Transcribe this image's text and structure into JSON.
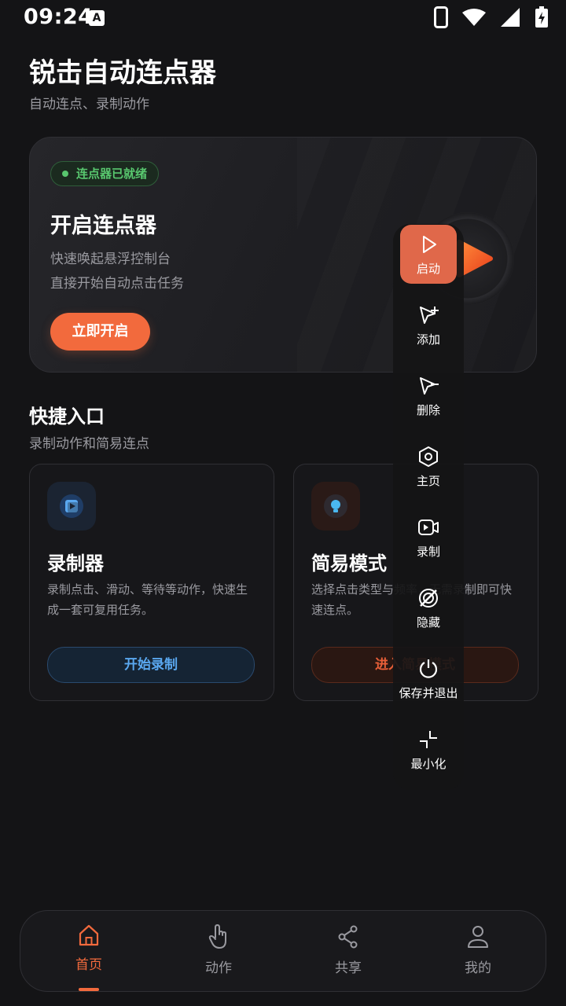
{
  "status_bar": {
    "time": "09:24",
    "badge_letter": "A"
  },
  "header": {
    "title": "锐击自动连点器",
    "subtitle": "自动连点、录制动作"
  },
  "hero": {
    "badge": "连点器已就绪",
    "title": "开启连点器",
    "desc_line1": "快速唤起悬浮控制台",
    "desc_line2": "直接开始自动点击任务",
    "button": "立即开启"
  },
  "quick": {
    "title": "快捷入口",
    "subtitle": "录制动作和简易连点",
    "cards": [
      {
        "title": "录制器",
        "desc": "录制点击、滑动、等待等动作，快速生成一套可复用任务。",
        "button": "开始录制",
        "icon": "record-video-icon"
      },
      {
        "title": "简易模式",
        "desc": "选择点击类型与频率，无需录制即可快速连点。",
        "button": "进入简易模式",
        "icon": "lightbulb-icon"
      }
    ]
  },
  "float_panel": {
    "items": [
      {
        "label": "启动",
        "icon": "play-icon"
      },
      {
        "label": "添加",
        "icon": "cursor-plus-icon"
      },
      {
        "label": "删除",
        "icon": "cursor-minus-icon"
      },
      {
        "label": "主页",
        "icon": "hexagon-icon"
      },
      {
        "label": "录制",
        "icon": "video-record-icon"
      },
      {
        "label": "隐藏",
        "icon": "hide-icon"
      },
      {
        "label": "保存并退出",
        "icon": "power-icon"
      },
      {
        "label": "最小化",
        "icon": "minimize-icon"
      }
    ]
  },
  "bottom_nav": {
    "items": [
      {
        "label": "首页",
        "icon": "home-icon",
        "active": true
      },
      {
        "label": "动作",
        "icon": "hand-icon",
        "active": false
      },
      {
        "label": "共享",
        "icon": "share-icon",
        "active": false
      },
      {
        "label": "我的",
        "icon": "user-icon",
        "active": false
      }
    ]
  },
  "colors": {
    "accent": "#f26a3d",
    "ready": "#58c66e",
    "blue": "#5aa8f0"
  }
}
